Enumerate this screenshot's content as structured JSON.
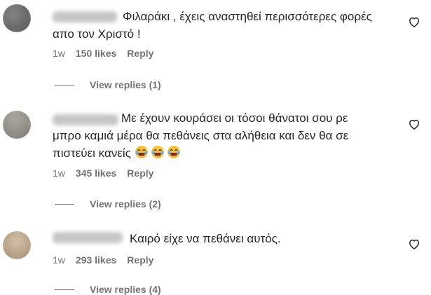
{
  "comments": [
    {
      "text_line1": "Φιλαράκι , έχεις αναστηθεί περισσότερες φορές",
      "text_line2": "απο τον Χριστό !",
      "time": "1w",
      "likes": "150 likes",
      "reply_label": "Reply",
      "view_replies": "View replies (1)",
      "avatar_color": "#6b6b6b"
    },
    {
      "text_line1": "Με έχουν κουράσει οι τόσοι θάνατοι σου ρε",
      "text_line2": "μπρο καμιά μέρα θα πεθάνεις στα αλήθεια και δεν θα σε",
      "text_line3": "πιστεύει κανείς",
      "emoji_icon": "laughing-crying-emoji-icon",
      "time": "1w",
      "likes": "345 likes",
      "reply_label": "Reply",
      "view_replies": "View replies (2)",
      "avatar_color": "#8f8f87"
    },
    {
      "text_line1": "Καιρό είχε να πεθάνει αυτός.",
      "time": "1w",
      "likes": "293 likes",
      "reply_label": "Reply",
      "view_replies": "View replies (4)",
      "avatar_color": "#b8a48e"
    }
  ],
  "icons": {
    "like": "heart-outline-icon"
  },
  "colors": {
    "text": "#262626",
    "secondary": "#737373"
  }
}
